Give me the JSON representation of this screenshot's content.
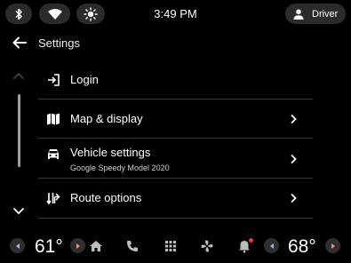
{
  "status_bar": {
    "time": "3:49 PM",
    "user_label": "Driver",
    "icons": [
      "bluetooth-icon",
      "wifi-icon",
      "brightness-icon",
      "person-icon"
    ]
  },
  "header": {
    "title": "Settings",
    "back_icon": "back-arrow-icon"
  },
  "settings": {
    "items": [
      {
        "label": "Login",
        "icon": "login-icon"
      },
      {
        "label": "Map & display",
        "icon": "map-icon"
      },
      {
        "label": "Vehicle settings",
        "subtitle": "Google Speedy Model 2020",
        "icon": "car-icon"
      },
      {
        "label": "Route options",
        "icon": "route-options-icon"
      }
    ]
  },
  "climate": {
    "left_temp": "61°",
    "right_temp": "68°"
  },
  "nav": {
    "icons": [
      "home-icon",
      "phone-icon",
      "apps-grid-icon",
      "fan-icon",
      "notifications-icon"
    ]
  },
  "colors": {
    "background": "#000000",
    "pill": "#2b2b2b",
    "arrow_accent": "#ff8a80",
    "notification_dot": "#e53935"
  }
}
